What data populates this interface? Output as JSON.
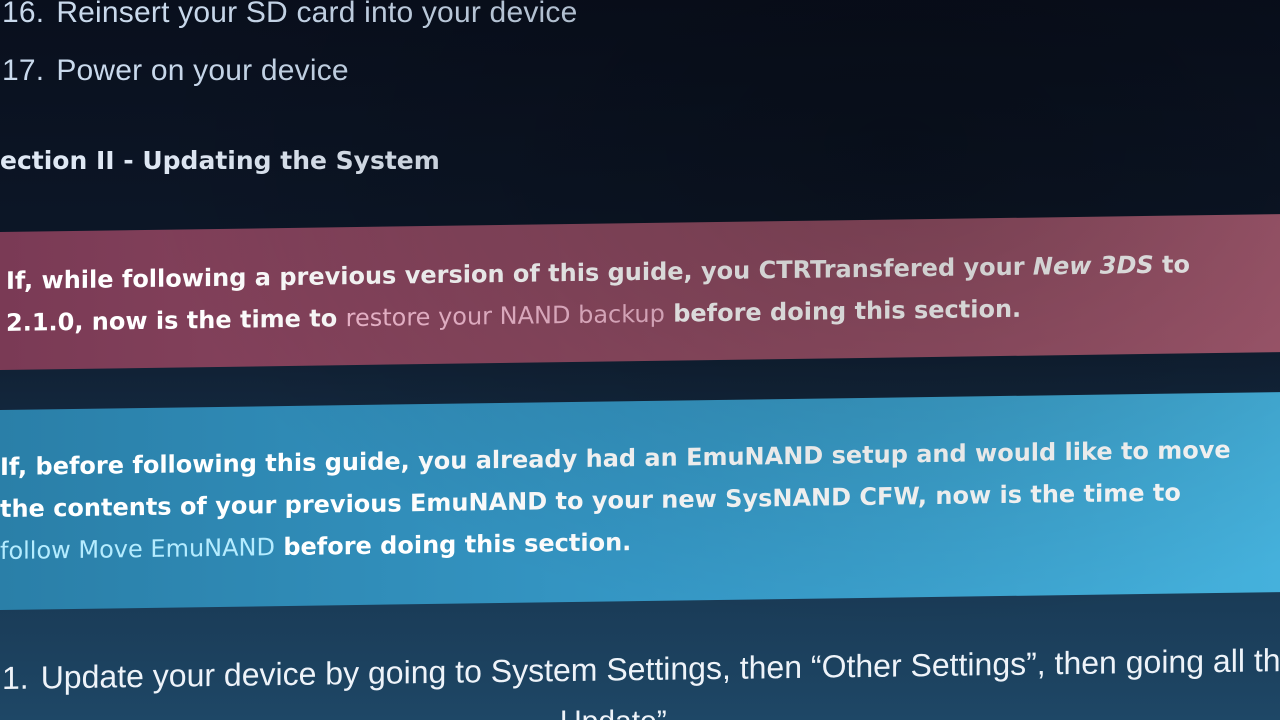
{
  "list_items": [
    {
      "number": "16.",
      "text": "Reinsert your SD card into your device"
    },
    {
      "number": "17.",
      "text": "Power on your device"
    }
  ],
  "section_heading": "ection II - Updating the System",
  "warning_notice": {
    "text_before": "If, while following a previous version of this guide, you CTRTransfered your ",
    "emphasis": "New 3DS",
    "text_middle": " to 2.1.0, now is the time to ",
    "link": "restore your NAND backup",
    "text_after": " before doing this section."
  },
  "info_notice": {
    "text_before": "If, before following this guide, you already had an EmuNAND setup and would like to move the contents of your previous EmuNAND to your new SysNAND CFW, now is the time to ",
    "link": "follow Move EmuNAND",
    "text_after": " before doing this section."
  },
  "step": {
    "number": "1.",
    "text": "Update your device by going to System Settings, then “Other Settings”, then going all th",
    "text_continued": "Update”"
  },
  "colors": {
    "warning_bg": "#8e4a62",
    "info_bg": "#3597c5",
    "link_pink": "#f0b9cf",
    "link_cyan": "#b5ecff"
  }
}
